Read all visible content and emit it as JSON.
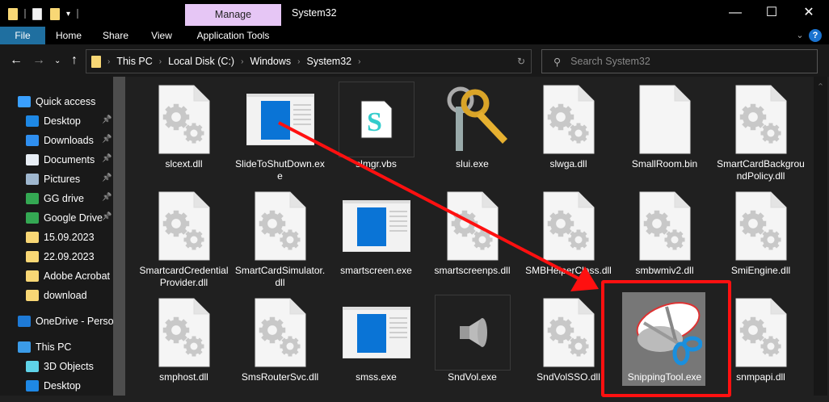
{
  "window": {
    "title": "System32",
    "context_tab": "Manage",
    "minimize": "—",
    "maximize": "☐",
    "close": "✕"
  },
  "ribbon": {
    "tabs": [
      "File",
      "Home",
      "Share",
      "View",
      "Application Tools"
    ],
    "accent": "#1f6fa0",
    "help": "?"
  },
  "nav": {
    "breadcrumb": [
      "This PC",
      "Local Disk (C:)",
      "Windows",
      "System32"
    ],
    "search_placeholder": "Search System32"
  },
  "sidebar": {
    "items": [
      {
        "label": "Quick access",
        "icon": "star-icon",
        "pinned": false,
        "indent": false
      },
      {
        "label": "Desktop",
        "icon": "desktop-icon",
        "pinned": true,
        "indent": true
      },
      {
        "label": "Downloads",
        "icon": "download-icon",
        "pinned": true,
        "indent": true
      },
      {
        "label": "Documents",
        "icon": "documents-icon",
        "pinned": true,
        "indent": true
      },
      {
        "label": "Pictures",
        "icon": "pictures-icon",
        "pinned": true,
        "indent": true
      },
      {
        "label": "GG drive",
        "icon": "google-drive-icon",
        "pinned": true,
        "indent": true
      },
      {
        "label": "Google Drive",
        "icon": "google-drive-icon",
        "pinned": true,
        "indent": true
      },
      {
        "label": "15.09.2023",
        "icon": "folder-icon",
        "pinned": false,
        "indent": true
      },
      {
        "label": "22.09.2023",
        "icon": "folder-icon",
        "pinned": false,
        "indent": true
      },
      {
        "label": "Adobe Acrobat P",
        "icon": "folder-icon",
        "pinned": false,
        "indent": true
      },
      {
        "label": "download",
        "icon": "folder-icon",
        "pinned": false,
        "indent": true
      },
      {
        "label": "OneDrive - Persor",
        "icon": "onedrive-icon",
        "pinned": false,
        "indent": false
      },
      {
        "label": "This PC",
        "icon": "computer-icon",
        "pinned": false,
        "indent": false
      },
      {
        "label": "3D Objects",
        "icon": "3d-objects-icon",
        "pinned": false,
        "indent": true
      },
      {
        "label": "Desktop",
        "icon": "desktop-icon",
        "pinned": false,
        "indent": true
      }
    ]
  },
  "files": [
    {
      "name": "slcext.dll",
      "type": "gear"
    },
    {
      "name": "SlideToShutDown.exe",
      "type": "app"
    },
    {
      "name": "slmgr.vbs",
      "type": "vbs"
    },
    {
      "name": "slui.exe",
      "type": "keys"
    },
    {
      "name": "slwga.dll",
      "type": "gear"
    },
    {
      "name": "SmallRoom.bin",
      "type": "blank"
    },
    {
      "name": "SmartCardBackgroundPolicy.dll",
      "type": "gear"
    },
    {
      "name": "SmartcardCredentialProvider.dll",
      "type": "gear"
    },
    {
      "name": "SmartCardSimulator.dll",
      "type": "gear"
    },
    {
      "name": "smartscreen.exe",
      "type": "app"
    },
    {
      "name": "smartscreenps.dll",
      "type": "gear"
    },
    {
      "name": "SMBHelperClass.dll",
      "type": "gear"
    },
    {
      "name": "smbwmiv2.dll",
      "type": "gear"
    },
    {
      "name": "SmiEngine.dll",
      "type": "gear"
    },
    {
      "name": "smphost.dll",
      "type": "gear"
    },
    {
      "name": "SmsRouterSvc.dll",
      "type": "gear"
    },
    {
      "name": "smss.exe",
      "type": "app"
    },
    {
      "name": "SndVol.exe",
      "type": "speaker"
    },
    {
      "name": "SndVolSSO.dll",
      "type": "gear"
    },
    {
      "name": "SnippingTool.exe",
      "type": "snip",
      "selected": true
    },
    {
      "name": "snmpapi.dll",
      "type": "gear"
    }
  ],
  "annotation": {
    "color": "#ff1010"
  }
}
